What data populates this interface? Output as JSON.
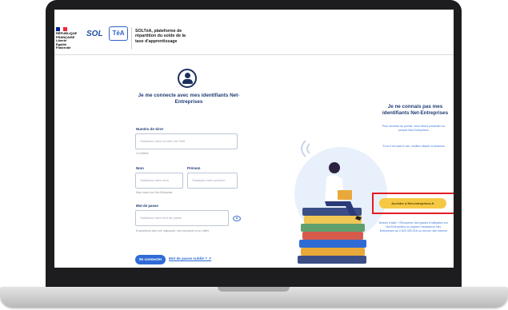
{
  "header": {
    "flag_text": "RÉPUBLIQUE\nFRANÇAISE\nLiberté\nÉgalité\nFraternité",
    "logo_text": "SOL",
    "logo_badge": "TéA",
    "app_title": "SOLTéA, plateforme de répartition du solde de la taxe d'apprentissage"
  },
  "login": {
    "title": "Je me connecte avec mes identifiants Net-Entreprises",
    "siret_label": "Numéro de Siret",
    "siret_placeholder": "Saisissez votre numéro de Siret",
    "siret_hint": "14 chiffres",
    "nom_label": "Nom",
    "nom_placeholder": "Saisissez votre nom",
    "prenom_label": "Prénom",
    "prenom_placeholder": "Saisissez votre prénom",
    "name_hint": "Nom inscrit sur Net-Entreprise",
    "password_label": "Mot de passe",
    "password_placeholder": "Saisissez votre mot de passe",
    "password_hint": "8 caractères dont une majuscule, une minuscule et un chiffre",
    "connect_label": "Se connecter",
    "forgot_label": "Mot de passe oublié ? ↗"
  },
  "register": {
    "title": "Je ne connais pas mes identifiants Net-Entreprises",
    "para1": "Pour accéder au portail, vous devez posséder un compte Net-Entreprises.",
    "para2": "Si ce n'est pas le cas, veuillez cliquer ci-dessous",
    "button_label": "Accéder à Net-entreprises.fr",
    "para3": "Besoin d'aide ? Récupérez des guides d'utilisation sur Net-Entreprises ou joignez l'assistance Net-Entreprises au 0 820 000 516 ou via leur site Internet"
  },
  "colors": {
    "brand_blue": "#1f3b74",
    "link_blue": "#2f6bd6",
    "button_yellow": "#f6c945",
    "highlight_red": "#e31b23"
  }
}
